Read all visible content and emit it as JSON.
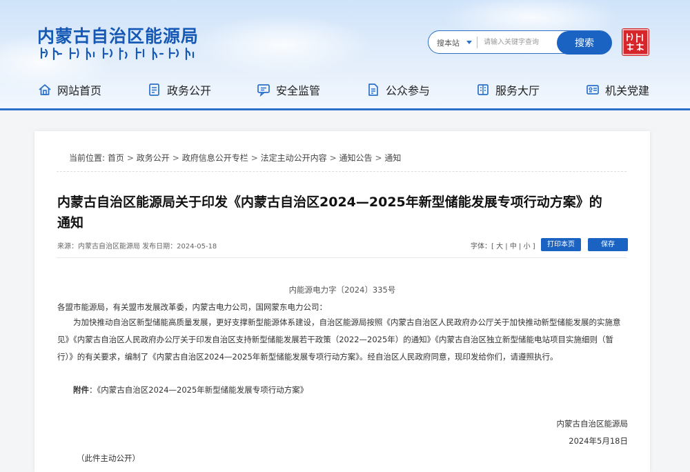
{
  "site": {
    "title": "内蒙古自治区能源局",
    "search": {
      "scope": "搜本站",
      "placeholder": "请输入关键字查询",
      "button": "搜索"
    }
  },
  "nav": {
    "items": [
      {
        "label": "网站首页",
        "icon": "home-icon"
      },
      {
        "label": "政务公开",
        "icon": "document-list-icon"
      },
      {
        "label": "安全监管",
        "icon": "chat-board-icon"
      },
      {
        "label": "公众参与",
        "icon": "file-icon"
      },
      {
        "label": "服务大厅",
        "icon": "book-icon"
      },
      {
        "label": "机关党建",
        "icon": "id-card-icon"
      }
    ]
  },
  "breadcrumb": {
    "label": "当前位置:",
    "items": [
      "首页",
      "政务公开",
      "政府信息公开专栏",
      "法定主动公开内容",
      "通知公告",
      "通知"
    ]
  },
  "article": {
    "title": "内蒙古自治区能源局关于印发《内蒙古自治区2024—2025年新型储能发展专项行动方案》的通知",
    "meta": "来源：内蒙古自治区能源局 发布日期：2024-05-18",
    "fontsize_label": "字体：",
    "fontsize_options": [
      "大",
      "中",
      "小"
    ],
    "print_button": "打印本页",
    "save_button": "保存",
    "doc_number": "内能源电力字〔2024〕335号",
    "addressee": "各盟市能源局，有关盟市发展改革委，内蒙古电力公司，国网蒙东电力公司：",
    "paragraph": "为加快推动自治区新型储能高质量发展，更好支撑新型能源体系建设，自治区能源局按照《内蒙古自治区人民政府办公厅关于加快推动新型储能发展的实施意见》《内蒙古自治区人民政府办公厅关于印发自治区支持新型储能发展若干政策（2022—2025年）的通知》《内蒙古自治区独立新型储能电站项目实施细则（暂行）》的有关要求，编制了《内蒙古自治区2024—2025年新型储能发展专项行动方案》。经自治区人民政府同意，现印发给你们，请遵照执行。",
    "attachment_label": "附件",
    "attachment_text": "：《内蒙古自治区2024—2025年新型储能发展专项行动方案》",
    "signature_org": "内蒙古自治区能源局",
    "signature_date": "2024年5月18日",
    "public_note": "（此件主动公开）"
  },
  "colors": {
    "brand_blue": "#1b63c2",
    "title_blue": "#1559b5",
    "seal_red": "#d7262b"
  }
}
